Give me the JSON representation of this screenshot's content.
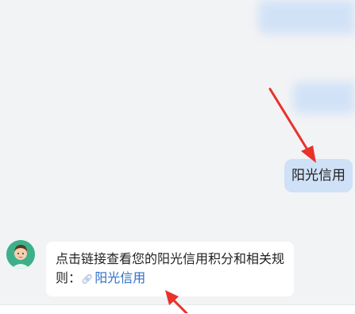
{
  "conversation": {
    "user_message": "阳光信用",
    "bot_message_text": "点击链接查看您的阳光信用积分和相关规则：",
    "bot_link_text": "阳光信用"
  },
  "colors": {
    "background": "#f2f3f5",
    "user_bubble": "#cfe1f7",
    "link": "#2f6fc6",
    "annotation_arrow": "#e8322b"
  },
  "icons": {
    "avatar": "customer-service-avatar-icon",
    "link": "link-icon",
    "annotation": "red-arrow-icon"
  }
}
